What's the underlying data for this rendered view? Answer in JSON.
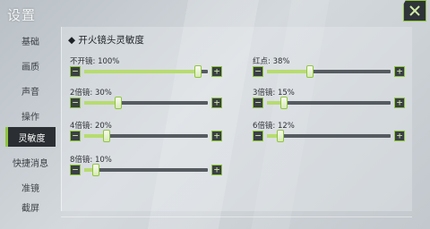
{
  "title": "设置",
  "sidebar": {
    "items": [
      {
        "label": "基础",
        "active": false
      },
      {
        "label": "画质",
        "active": false
      },
      {
        "label": "声音",
        "active": false
      },
      {
        "label": "操作",
        "active": false
      },
      {
        "label": "灵敏度",
        "active": true
      },
      {
        "label": "快捷消息",
        "active": false
      },
      {
        "label": "准镜",
        "active": false
      },
      {
        "label": "截屏",
        "active": false
      }
    ]
  },
  "section_title": "◆ 开火镜头灵敏度",
  "sliders": [
    {
      "label": "不开镜: 100%",
      "value": 100
    },
    {
      "label": "红点: 38%",
      "value": 38
    },
    {
      "label": "2倍镜: 30%",
      "value": 30
    },
    {
      "label": "3倍镜: 15%",
      "value": 15
    },
    {
      "label": "4倍镜: 20%",
      "value": 20
    },
    {
      "label": "6倍镜: 12%",
      "value": 12
    },
    {
      "label": "8倍镜: 10%",
      "value": 10
    }
  ],
  "controls": {
    "minus": "−",
    "plus": "+"
  },
  "colors": {
    "accent": "#8fc63d",
    "dark": "#2b2f33",
    "track": "#555b60",
    "fill": "#b7dc6e"
  }
}
